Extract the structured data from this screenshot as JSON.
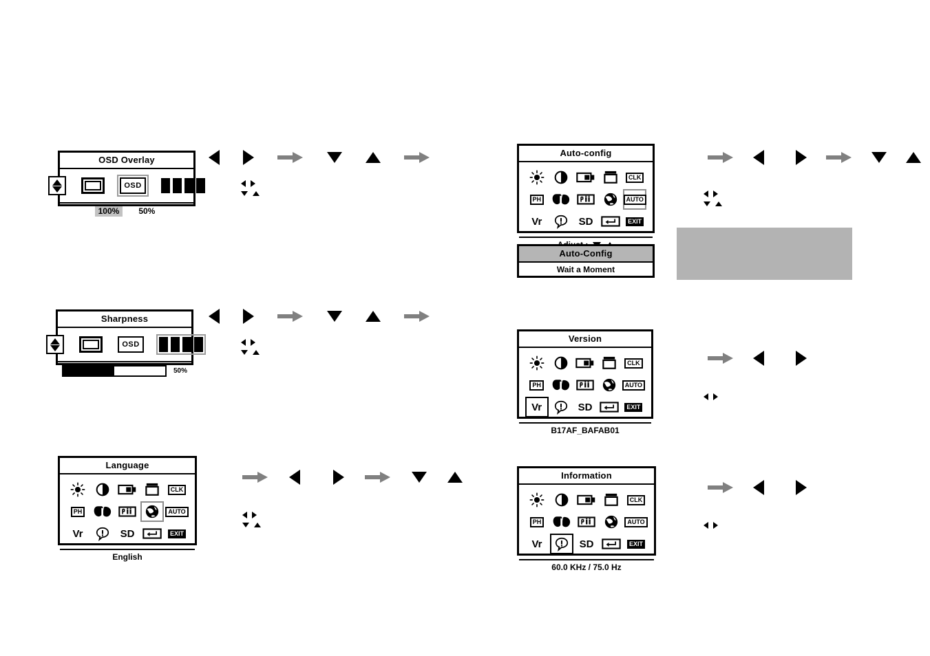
{
  "page": {
    "background": "#ffffff",
    "selection_border_color": "#8c8c8c",
    "highlight_fill": "#c2c2c2",
    "gray_arrow_color": "#808080",
    "gray_block_color": "#b3b3b3"
  },
  "icon_names": {
    "brightness": "brightness-icon",
    "contrast": "contrast-icon",
    "h_position": "horizontal-position-icon",
    "v_position": "vertical-position-icon",
    "clk": "clock-icon",
    "ph": "phase-icon",
    "color": "color-icon",
    "size": "size-icon",
    "language": "language-globe-icon",
    "auto": "auto-config-icon",
    "vr": "version-icon",
    "info": "information-icon",
    "sd": "sd-icon",
    "reset": "reset-enter-icon",
    "exit": "exit-icon"
  },
  "icon_labels": {
    "clk": "CLK",
    "ph": "PH",
    "auto": "AUTO",
    "vr": "Vr",
    "sd": "SD",
    "exit": "EXIT"
  },
  "panels": {
    "osd_overlay": {
      "title": "OSD Overlay",
      "pictograms": [
        "updown-arrows-icon",
        "screen-icon",
        "osd-icon",
        "sharpness-bars-icon"
      ],
      "selected_pictogram": "osd-icon",
      "values": [
        {
          "label": "100%",
          "selected": true
        },
        {
          "label": "50%",
          "selected": false
        }
      ]
    },
    "sharpness": {
      "title": "Sharpness",
      "pictograms": [
        "updown-arrows-icon",
        "screen-icon",
        "osd-icon",
        "sharpness-bars-icon"
      ],
      "selected_pictogram": "sharpness-bars-icon",
      "slider": {
        "percent": 50,
        "label": "50%"
      }
    },
    "language": {
      "title": "Language",
      "selected_icon": "language-globe-icon",
      "footer": "English"
    },
    "auto_config": {
      "title": "Auto-config",
      "selected_icon": "auto-config-icon",
      "footer": "Adjust :"
    },
    "auto_config_wait": {
      "title": "Auto-Config",
      "footer": "Wait a Moment"
    },
    "version": {
      "title": "Version",
      "selected_icon": "version-icon",
      "footer": "B17AF_BAFAB01"
    },
    "information": {
      "title": "Information",
      "selected_icon": "information-icon",
      "footer": "60.0 KHz / 75.0 Hz"
    }
  },
  "arrow_sequences": {
    "osd_overlay": [
      "left-black",
      "right-black",
      "right-gray",
      "down-black",
      "up-black",
      "right-gray"
    ],
    "sharpness": [
      "left-black",
      "right-black",
      "right-gray",
      "down-black",
      "up-black",
      "right-gray"
    ],
    "language": [
      "right-gray",
      "left-black",
      "right-black",
      "right-gray",
      "down-black",
      "up-black"
    ],
    "auto_config": [
      "right-gray",
      "left-black",
      "right-black",
      "right-gray",
      "down-black",
      "up-black"
    ],
    "version": [
      "right-gray",
      "left-black",
      "right-black"
    ],
    "information": [
      "right-gray",
      "left-black",
      "right-black"
    ]
  },
  "mini_key_hints": {
    "lr_only": [
      "left-small",
      "right-small"
    ],
    "lr_ud": [
      "left-small",
      "right-small",
      "down-small",
      "up-small"
    ]
  }
}
